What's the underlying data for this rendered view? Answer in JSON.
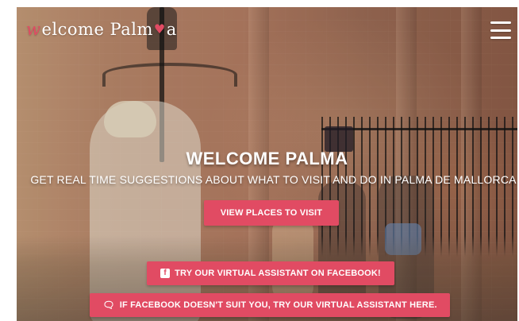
{
  "header": {
    "logo_text": "welcome Palma",
    "logo_parts": {
      "w": "w",
      "rest": "elcome Palm",
      "heart": "♥",
      "a": "a"
    },
    "menu_icon": "hamburger-menu-icon"
  },
  "hero": {
    "title": "WELCOME PALMA",
    "subtitle": "GET REAL TIME SUGGESTIONS ABOUT WHAT TO VISIT AND DO IN PALMA DE MALLORCA",
    "buttons": [
      {
        "label": "VIEW PLACES TO VISIT"
      },
      {
        "label": "TRY OUR VIRTUAL ASSISTANT ON FACEBOOK!",
        "icon": "facebook-icon",
        "icon_glyph": "f"
      },
      {
        "label": "IF FACEBOOK DOESN'T SUIT YOU, TRY OUR VIRTUAL ASSISTANT HERE.",
        "icon": "chat-icon",
        "icon_glyph": "🗨"
      }
    ]
  },
  "colors": {
    "accent": "#e14b63",
    "text_on_image": "#ffffff"
  }
}
